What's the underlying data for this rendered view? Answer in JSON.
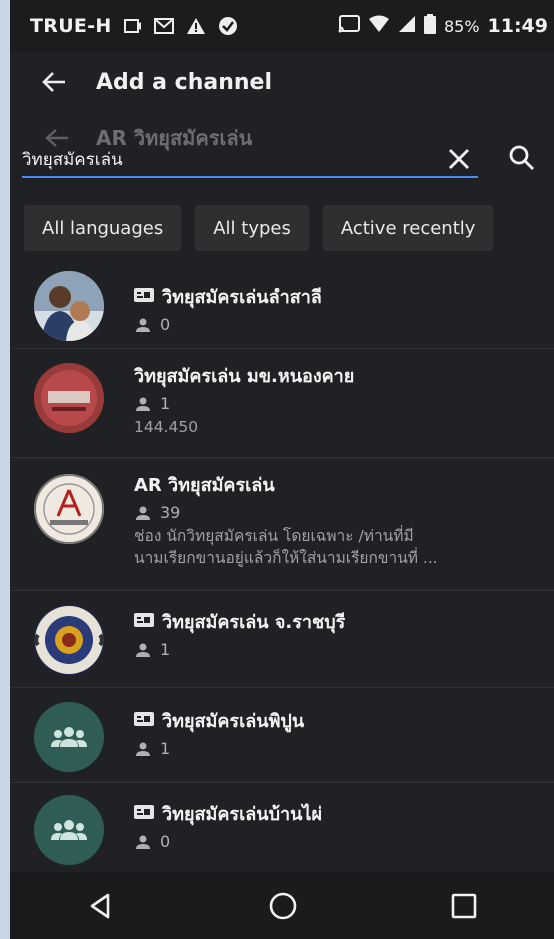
{
  "status_bar": {
    "carrier": "TRUE-H",
    "battery": "85%",
    "time": "11:49"
  },
  "app_bar": {
    "title": "Add a channel"
  },
  "search": {
    "previous_query": "AR วิทยุสมัครเล่น",
    "value": "วิทยุสมัครเล่น"
  },
  "filters": [
    {
      "label": "All languages"
    },
    {
      "label": "All types"
    },
    {
      "label": "Active recently"
    }
  ],
  "channels": [
    {
      "name": "วิทยุสมัครเล่นลำสาลี",
      "members": "0",
      "has_tag": true,
      "avatar": "photo-icon"
    },
    {
      "name": "วิทยุสมัครเล่น มข.หนองคาย",
      "members": "1",
      "extra": "144.450",
      "has_tag": false,
      "avatar": "logo-icon"
    },
    {
      "name": "AR วิทยุสมัครเล่น",
      "members": "39",
      "desc1": "ช่อง นักวิทยุสมัครเล่น โดยเฉพาะ /ท่านที่มี",
      "desc2": "นามเรียกขานอยู่แล้วก็ให้ใส่นามเรียกขานที่ ...",
      "has_tag": false,
      "avatar": "logo-icon"
    },
    {
      "name": "วิทยุสมัครเล่น จ.ราชบุรี",
      "members": "1",
      "has_tag": true,
      "avatar": "emblem-icon"
    },
    {
      "name": "วิทยุสมัครเล่นพิปูน",
      "members": "1",
      "has_tag": true,
      "avatar": "group-icon"
    },
    {
      "name": "วิทยุสมัครเล่นบ้านไผ่",
      "members": "0",
      "has_tag": true,
      "avatar": "group-icon"
    }
  ],
  "colors": {
    "background": "#202124",
    "accent": "#4a8af4",
    "group_avatar": "#2f5d55"
  }
}
